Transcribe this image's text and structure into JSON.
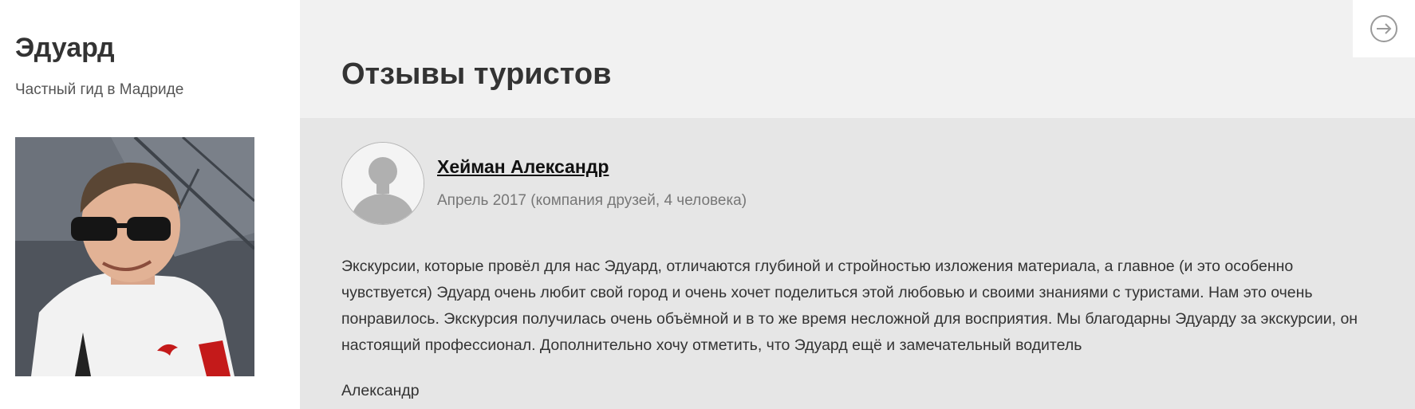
{
  "sidebar": {
    "guide_name": "Эдуард",
    "guide_subtitle": "Частный гид в Мадриде",
    "photo_icon": "guide-photo"
  },
  "main": {
    "title": "Отзывы туристов",
    "exit_icon": "exit-icon"
  },
  "review": {
    "author": "Хейман Александр",
    "meta": "Апрель 2017 (компания друзей, 4 человека)",
    "text": "Экскурсии, которые провёл для нас Эдуард, отличаются глубиной и стройностью изложения материала, а главное (и это особенно чувствуется) Эдуард очень любит свой город и очень хочет поделиться этой любовью и своими знаниями с туристами. Нам это очень понравилось. Экскурсия получилась очень объёмной и в то же время несложной для восприятия. Мы благодарны Эдуарду за экскурсии, он настоящий профессионал. Дополнительно хочу отметить, что Эдуард ещё и замечательный водитель",
    "signature": "Александр",
    "avatar_icon": "default-avatar-icon"
  },
  "colors": {
    "main_background": "#f1f1f1",
    "review_background": "#e6e6e6",
    "text": "#333333",
    "muted_text": "#777777"
  }
}
